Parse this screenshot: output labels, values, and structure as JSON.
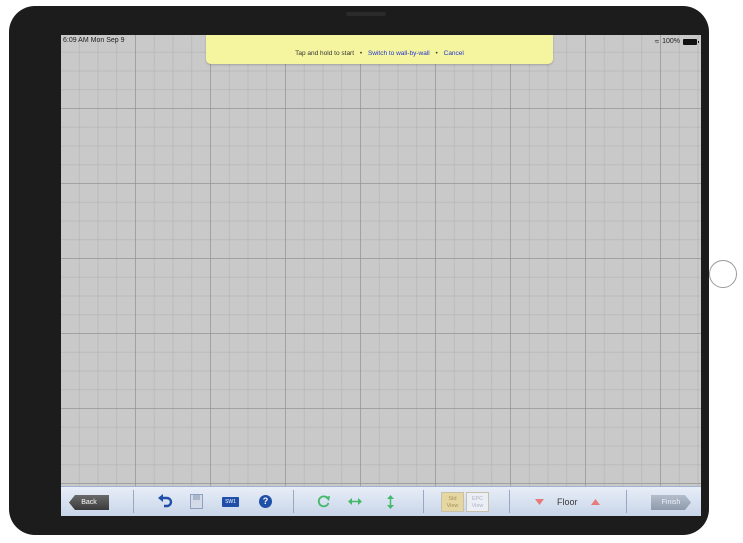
{
  "status_bar": {
    "time": "6:09 AM  Mon Sep 9",
    "battery": "100%"
  },
  "banner": {
    "instruction": "Tap and hold to start",
    "switch_link": "Switch to wall-by-wall",
    "cancel_link": "Cancel",
    "bullet": "•"
  },
  "toolbar": {
    "back_label": "Back",
    "sw1_label": "SW1",
    "help_label": "?",
    "std_view_line1": "Std",
    "std_view_line2": "View",
    "epc_view_line1": "EPC",
    "epc_view_line2": "View",
    "floor_label": "Floor",
    "finish_label": "Finish"
  },
  "colors": {
    "banner_bg": "#f6f59f",
    "link": "#2233cc",
    "toolbar_icon_blue": "#1f4fa8",
    "toolbar_icon_green": "#45b86a",
    "floor_arrow": "#e77b7b"
  }
}
